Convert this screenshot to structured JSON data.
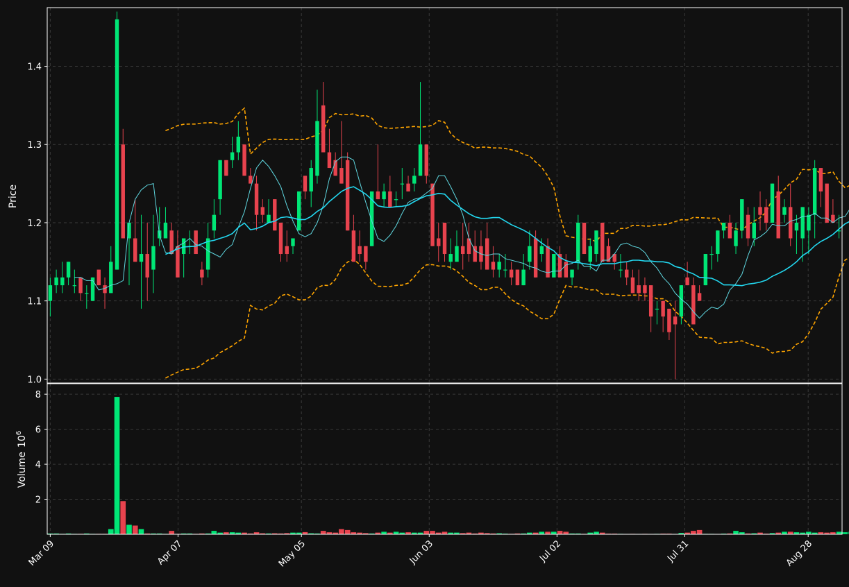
{
  "colors": {
    "background": "#111111",
    "axes_frame": "#ffffff",
    "grid": "#3a3a3a",
    "text": "#ffffff",
    "up": "#00e676",
    "down": "#e8434e",
    "sma_fast": "#5fd7e0",
    "sma_slow": "#22d8f0",
    "bollinger": "#ffa500"
  },
  "chart_data": [
    {
      "type": "candlestick",
      "panel": "price",
      "xlabel": "",
      "ylabel": "Price",
      "ylim": [
        0.995,
        1.475
      ],
      "yticks": [
        "1.0",
        "1.1",
        "1.2",
        "1.3",
        "1.4"
      ],
      "grid": true,
      "date_range": [
        "2015-03-09",
        "2015-09-04"
      ],
      "x_ticks": [
        {
          "date": "2015-03-09",
          "label": "Mar 09"
        },
        {
          "date": "2015-04-07",
          "label": "Apr 07"
        },
        {
          "date": "2015-05-05",
          "label": "May 05"
        },
        {
          "date": "2015-06-03",
          "label": "Jun 03"
        },
        {
          "date": "2015-07-02",
          "label": "Jul 02"
        },
        {
          "date": "2015-07-31",
          "label": "Jul 31"
        },
        {
          "date": "2015-08-28",
          "label": "Aug 28"
        }
      ],
      "close": [
        1.12,
        1.13,
        1.13,
        1.15,
        1.12,
        1.12,
        1.11,
        1.13,
        1.09,
        1.13,
        1.14,
        1.12,
        1.15,
        1.46,
        1.28,
        1.2,
        1.15,
        1.16,
        1.13,
        1.17,
        1.19,
        1.2,
        1.18,
        1.16,
        1.13,
        1.18,
        1.17,
        1.16,
        1.14,
        1.18,
        1.21,
        1.28,
        1.26,
        1.29,
        1.31,
        1.26,
        1.24,
        1.2,
        1.22,
        1.19,
        1.16,
        1.16,
        1.18,
        1.24,
        1.26,
        1.27,
        1.33,
        1.29,
        1.27,
        1.26,
        1.25,
        1.19,
        1.16,
        1.15,
        1.15,
        1.23,
        1.23,
        1.22,
        1.23,
        1.22,
        1.25,
        1.24,
        1.25,
        1.26,
        1.3,
        1.25,
        1.17,
        1.17,
        1.16,
        1.15,
        1.17,
        1.15,
        1.16,
        1.17,
        1.15,
        1.14,
        1.14,
        1.15,
        1.16,
        1.13,
        1.13,
        1.12,
        1.14,
        1.17,
        1.13,
        1.17,
        1.13,
        1.16,
        1.13,
        1.13,
        1.14,
        1.2,
        1.16,
        1.17,
        1.19,
        1.15,
        1.18,
        1.15,
        1.14,
        1.13,
        1.11,
        1.12,
        1.11,
        1.08,
        1.09,
        1.08,
        1.07,
        1.07,
        1.12,
        1.12,
        1.07,
        1.1,
        1.16,
        1.16,
        1.18,
        1.19,
        1.2,
        1.18,
        1.19,
        1.23,
        1.18,
        1.2,
        1.21,
        1.2,
        1.25,
        1.18,
        1.22,
        1.18,
        1.2,
        1.22,
        1.21,
        1.23,
        1.24,
        1.25,
        1.2,
        1.2,
        1.19
      ],
      "candles": [
        {
          "o": 1.1,
          "h": 1.13,
          "l": 1.08,
          "c": 1.12
        },
        {
          "o": 1.12,
          "h": 1.14,
          "l": 1.11,
          "c": 1.13
        },
        {
          "o": 1.12,
          "h": 1.15,
          "l": 1.11,
          "c": 1.13
        },
        {
          "o": 1.13,
          "h": 1.15,
          "l": 1.12,
          "c": 1.15
        },
        {
          "o": 1.12,
          "h": 1.14,
          "l": 1.11,
          "c": 1.12
        },
        {
          "o": 1.13,
          "h": 1.13,
          "l": 1.1,
          "c": 1.11
        },
        {
          "o": 1.11,
          "h": 1.12,
          "l": 1.09,
          "c": 1.11
        },
        {
          "o": 1.1,
          "h": 1.13,
          "l": 1.1,
          "c": 1.13
        },
        {
          "o": 1.14,
          "h": 1.14,
          "l": 1.12,
          "c": 1.12
        },
        {
          "o": 1.12,
          "h": 1.13,
          "l": 1.09,
          "c": 1.11
        },
        {
          "o": 1.11,
          "h": 1.17,
          "l": 1.11,
          "c": 1.15
        },
        {
          "o": 1.14,
          "h": 1.47,
          "l": 1.14,
          "c": 1.46
        },
        {
          "o": 1.3,
          "h": 1.32,
          "l": 1.18,
          "c": 1.18
        },
        {
          "o": 1.18,
          "h": 1.2,
          "l": 1.12,
          "c": 1.2
        },
        {
          "o": 1.18,
          "h": 1.23,
          "l": 1.15,
          "c": 1.15
        },
        {
          "o": 1.15,
          "h": 1.21,
          "l": 1.09,
          "c": 1.16
        },
        {
          "o": 1.16,
          "h": 1.2,
          "l": 1.1,
          "c": 1.13
        },
        {
          "o": 1.14,
          "h": 1.21,
          "l": 1.11,
          "c": 1.17
        },
        {
          "o": 1.18,
          "h": 1.22,
          "l": 1.17,
          "c": 1.19
        },
        {
          "o": 1.18,
          "h": 1.22,
          "l": 1.18,
          "c": 1.2
        },
        {
          "o": 1.19,
          "h": 1.2,
          "l": 1.16,
          "c": 1.16
        },
        {
          "o": 1.17,
          "h": 1.19,
          "l": 1.13,
          "c": 1.13
        },
        {
          "o": 1.16,
          "h": 1.18,
          "l": 1.13,
          "c": 1.18
        },
        {
          "o": 1.17,
          "h": 1.19,
          "l": 1.16,
          "c": 1.17
        },
        {
          "o": 1.19,
          "h": 1.19,
          "l": 1.16,
          "c": 1.16
        },
        {
          "o": 1.14,
          "h": 1.15,
          "l": 1.12,
          "c": 1.13
        },
        {
          "o": 1.14,
          "h": 1.2,
          "l": 1.13,
          "c": 1.18
        },
        {
          "o": 1.19,
          "h": 1.23,
          "l": 1.18,
          "c": 1.21
        },
        {
          "o": 1.23,
          "h": 1.28,
          "l": 1.21,
          "c": 1.28
        },
        {
          "o": 1.28,
          "h": 1.28,
          "l": 1.26,
          "c": 1.26
        },
        {
          "o": 1.28,
          "h": 1.31,
          "l": 1.27,
          "c": 1.29
        },
        {
          "o": 1.29,
          "h": 1.33,
          "l": 1.28,
          "c": 1.31
        },
        {
          "o": 1.3,
          "h": 1.3,
          "l": 1.26,
          "c": 1.26
        },
        {
          "o": 1.26,
          "h": 1.27,
          "l": 1.25,
          "c": 1.25
        },
        {
          "o": 1.25,
          "h": 1.26,
          "l": 1.19,
          "c": 1.21
        },
        {
          "o": 1.22,
          "h": 1.23,
          "l": 1.2,
          "c": 1.21
        },
        {
          "o": 1.2,
          "h": 1.23,
          "l": 1.2,
          "c": 1.21
        },
        {
          "o": 1.23,
          "h": 1.23,
          "l": 1.19,
          "c": 1.19
        },
        {
          "o": 1.2,
          "h": 1.2,
          "l": 1.15,
          "c": 1.16
        },
        {
          "o": 1.17,
          "h": 1.19,
          "l": 1.15,
          "c": 1.16
        },
        {
          "o": 1.17,
          "h": 1.18,
          "l": 1.16,
          "c": 1.18
        },
        {
          "o": 1.19,
          "h": 1.24,
          "l": 1.19,
          "c": 1.24
        },
        {
          "o": 1.26,
          "h": 1.26,
          "l": 1.23,
          "c": 1.24
        },
        {
          "o": 1.24,
          "h": 1.28,
          "l": 1.22,
          "c": 1.27
        },
        {
          "o": 1.26,
          "h": 1.37,
          "l": 1.25,
          "c": 1.33
        },
        {
          "o": 1.35,
          "h": 1.38,
          "l": 1.29,
          "c": 1.29
        },
        {
          "o": 1.29,
          "h": 1.32,
          "l": 1.27,
          "c": 1.27
        },
        {
          "o": 1.28,
          "h": 1.29,
          "l": 1.26,
          "c": 1.26
        },
        {
          "o": 1.27,
          "h": 1.33,
          "l": 1.25,
          "c": 1.25
        },
        {
          "o": 1.28,
          "h": 1.29,
          "l": 1.19,
          "c": 1.19
        },
        {
          "o": 1.19,
          "h": 1.21,
          "l": 1.15,
          "c": 1.15
        },
        {
          "o": 1.17,
          "h": 1.19,
          "l": 1.15,
          "c": 1.16
        },
        {
          "o": 1.17,
          "h": 1.17,
          "l": 1.14,
          "c": 1.15
        },
        {
          "o": 1.17,
          "h": 1.24,
          "l": 1.17,
          "c": 1.24
        },
        {
          "o": 1.24,
          "h": 1.3,
          "l": 1.23,
          "c": 1.23
        },
        {
          "o": 1.23,
          "h": 1.25,
          "l": 1.22,
          "c": 1.24
        },
        {
          "o": 1.24,
          "h": 1.26,
          "l": 1.22,
          "c": 1.22
        },
        {
          "o": 1.23,
          "h": 1.24,
          "l": 1.22,
          "c": 1.23
        },
        {
          "o": 1.25,
          "h": 1.27,
          "l": 1.23,
          "c": 1.25
        },
        {
          "o": 1.25,
          "h": 1.26,
          "l": 1.24,
          "c": 1.24
        },
        {
          "o": 1.25,
          "h": 1.27,
          "l": 1.24,
          "c": 1.26
        },
        {
          "o": 1.26,
          "h": 1.38,
          "l": 1.26,
          "c": 1.3
        },
        {
          "o": 1.3,
          "h": 1.3,
          "l": 1.25,
          "c": 1.26
        },
        {
          "o": 1.25,
          "h": 1.25,
          "l": 1.17,
          "c": 1.17
        },
        {
          "o": 1.18,
          "h": 1.2,
          "l": 1.15,
          "c": 1.17
        },
        {
          "o": 1.2,
          "h": 1.2,
          "l": 1.15,
          "c": 1.16
        },
        {
          "o": 1.15,
          "h": 1.18,
          "l": 1.14,
          "c": 1.16
        },
        {
          "o": 1.15,
          "h": 1.19,
          "l": 1.15,
          "c": 1.17
        },
        {
          "o": 1.17,
          "h": 1.2,
          "l": 1.14,
          "c": 1.16
        },
        {
          "o": 1.18,
          "h": 1.2,
          "l": 1.15,
          "c": 1.16
        },
        {
          "o": 1.17,
          "h": 1.19,
          "l": 1.16,
          "c": 1.15
        },
        {
          "o": 1.17,
          "h": 1.19,
          "l": 1.14,
          "c": 1.15
        },
        {
          "o": 1.18,
          "h": 1.2,
          "l": 1.14,
          "c": 1.14
        },
        {
          "o": 1.15,
          "h": 1.17,
          "l": 1.13,
          "c": 1.14
        },
        {
          "o": 1.14,
          "h": 1.16,
          "l": 1.13,
          "c": 1.15
        },
        {
          "o": 1.14,
          "h": 1.16,
          "l": 1.13,
          "c": 1.14
        },
        {
          "o": 1.14,
          "h": 1.15,
          "l": 1.12,
          "c": 1.13
        },
        {
          "o": 1.14,
          "h": 1.14,
          "l": 1.12,
          "c": 1.12
        },
        {
          "o": 1.12,
          "h": 1.16,
          "l": 1.12,
          "c": 1.14
        },
        {
          "o": 1.15,
          "h": 1.19,
          "l": 1.14,
          "c": 1.17
        },
        {
          "o": 1.18,
          "h": 1.19,
          "l": 1.13,
          "c": 1.13
        },
        {
          "o": 1.16,
          "h": 1.18,
          "l": 1.15,
          "c": 1.17
        },
        {
          "o": 1.17,
          "h": 1.18,
          "l": 1.13,
          "c": 1.13
        },
        {
          "o": 1.13,
          "h": 1.16,
          "l": 1.13,
          "c": 1.16
        },
        {
          "o": 1.16,
          "h": 1.17,
          "l": 1.13,
          "c": 1.13
        },
        {
          "o": 1.15,
          "h": 1.16,
          "l": 1.13,
          "c": 1.13
        },
        {
          "o": 1.13,
          "h": 1.14,
          "l": 1.12,
          "c": 1.14
        },
        {
          "o": 1.15,
          "h": 1.21,
          "l": 1.14,
          "c": 1.2
        },
        {
          "o": 1.2,
          "h": 1.2,
          "l": 1.16,
          "c": 1.16
        },
        {
          "o": 1.15,
          "h": 1.18,
          "l": 1.14,
          "c": 1.17
        },
        {
          "o": 1.16,
          "h": 1.19,
          "l": 1.15,
          "c": 1.19
        },
        {
          "o": 1.2,
          "h": 1.2,
          "l": 1.15,
          "c": 1.15
        },
        {
          "o": 1.17,
          "h": 1.18,
          "l": 1.15,
          "c": 1.15
        },
        {
          "o": 1.16,
          "h": 1.16,
          "l": 1.14,
          "c": 1.15
        },
        {
          "o": 1.14,
          "h": 1.16,
          "l": 1.13,
          "c": 1.14
        },
        {
          "o": 1.14,
          "h": 1.15,
          "l": 1.12,
          "c": 1.13
        },
        {
          "o": 1.13,
          "h": 1.14,
          "l": 1.11,
          "c": 1.11
        },
        {
          "o": 1.12,
          "h": 1.14,
          "l": 1.1,
          "c": 1.11
        },
        {
          "o": 1.12,
          "h": 1.13,
          "l": 1.1,
          "c": 1.11
        },
        {
          "o": 1.12,
          "h": 1.12,
          "l": 1.06,
          "c": 1.08
        },
        {
          "o": 1.09,
          "h": 1.1,
          "l": 1.07,
          "c": 1.09
        },
        {
          "o": 1.1,
          "h": 1.1,
          "l": 1.06,
          "c": 1.08
        },
        {
          "o": 1.09,
          "h": 1.09,
          "l": 1.05,
          "c": 1.06
        },
        {
          "o": 1.08,
          "h": 1.1,
          "l": 1,
          "c": 1.07
        },
        {
          "o": 1.08,
          "h": 1.12,
          "l": 1.07,
          "c": 1.12
        },
        {
          "o": 1.13,
          "h": 1.15,
          "l": 1.12,
          "c": 1.12
        },
        {
          "o": 1.12,
          "h": 1.13,
          "l": 1.07,
          "c": 1.07
        },
        {
          "o": 1.11,
          "h": 1.12,
          "l": 1.1,
          "c": 1.1
        },
        {
          "o": 1.12,
          "h": 1.16,
          "l": 1.12,
          "c": 1.16
        },
        {
          "o": 1.16,
          "h": 1.17,
          "l": 1.14,
          "c": 1.16
        },
        {
          "o": 1.16,
          "h": 1.19,
          "l": 1.15,
          "c": 1.19
        },
        {
          "o": 1.19,
          "h": 1.2,
          "l": 1.18,
          "c": 1.2
        },
        {
          "o": 1.2,
          "h": 1.21,
          "l": 1.18,
          "c": 1.18
        },
        {
          "o": 1.17,
          "h": 1.2,
          "l": 1.16,
          "c": 1.19
        },
        {
          "o": 1.19,
          "h": 1.23,
          "l": 1.18,
          "c": 1.23
        },
        {
          "o": 1.21,
          "h": 1.22,
          "l": 1.17,
          "c": 1.18
        },
        {
          "o": 1.18,
          "h": 1.22,
          "l": 1.17,
          "c": 1.2
        },
        {
          "o": 1.22,
          "h": 1.24,
          "l": 1.19,
          "c": 1.21
        },
        {
          "o": 1.22,
          "h": 1.23,
          "l": 1.19,
          "c": 1.2
        },
        {
          "o": 1.2,
          "h": 1.25,
          "l": 1.2,
          "c": 1.25
        },
        {
          "o": 1.24,
          "h": 1.26,
          "l": 1.2,
          "c": 1.18
        },
        {
          "o": 1.21,
          "h": 1.23,
          "l": 1.2,
          "c": 1.22
        },
        {
          "o": 1.22,
          "h": 1.25,
          "l": 1.17,
          "c": 1.18
        },
        {
          "o": 1.19,
          "h": 1.21,
          "l": 1.16,
          "c": 1.2
        },
        {
          "o": 1.18,
          "h": 1.22,
          "l": 1.15,
          "c": 1.22
        },
        {
          "o": 1.19,
          "h": 1.22,
          "l": 1.16,
          "c": 1.21
        },
        {
          "o": 1.21,
          "h": 1.28,
          "l": 1.18,
          "c": 1.27
        },
        {
          "o": 1.27,
          "h": 1.27,
          "l": 1.22,
          "c": 1.24
        },
        {
          "o": 1.25,
          "h": 1.25,
          "l": 1.2,
          "c": 1.2
        },
        {
          "o": 1.21,
          "h": 1.23,
          "l": 1.2,
          "c": 1.2
        },
        {
          "o": 1.19,
          "h": 1.21,
          "l": 1.18,
          "c": 1.19
        }
      ],
      "moving_averages": [
        {
          "period": 5,
          "color": "#5fd7e0"
        },
        {
          "period": 20,
          "color": "#22d8f0"
        }
      ],
      "bollinger": {
        "period": 20,
        "std_mult": 2,
        "color": "#ffa500",
        "style": "dashed"
      }
    },
    {
      "type": "bar",
      "panel": "volume",
      "ylabel": "Volume",
      "ylabel_exponent": "10",
      "ylabel_exponent_power": "6",
      "ylim": [
        0,
        8.6
      ],
      "yticks": [
        "2",
        "4",
        "6",
        "8"
      ],
      "grid": true,
      "values": [
        0.05,
        0.05,
        0.03,
        0.05,
        0.03,
        0.03,
        0.05,
        0.03,
        0.03,
        0.03,
        0.3,
        7.85,
        1.9,
        0.55,
        0.5,
        0.3,
        0.05,
        0.05,
        0.05,
        0.03,
        0.2,
        0.03,
        0.05,
        0.05,
        0.03,
        0.05,
        0.05,
        0.2,
        0.1,
        0.12,
        0.12,
        0.1,
        0.1,
        0.05,
        0.12,
        0.06,
        0.05,
        0.06,
        0.05,
        0.07,
        0.1,
        0.1,
        0.13,
        0.06,
        0.05,
        0.2,
        0.12,
        0.1,
        0.3,
        0.25,
        0.12,
        0.1,
        0.07,
        0.05,
        0.1,
        0.15,
        0.1,
        0.15,
        0.1,
        0.12,
        0.1,
        0.1,
        0.2,
        0.2,
        0.1,
        0.15,
        0.1,
        0.1,
        0.07,
        0.1,
        0.05,
        0.1,
        0.07,
        0.05,
        0.06,
        0.04,
        0.03,
        0.05,
        0.05,
        0.1,
        0.1,
        0.15,
        0.15,
        0.15,
        0.2,
        0.15,
        0.05,
        0.05,
        0.03,
        0.1,
        0.15,
        0.1,
        0.04,
        0.04,
        0.03,
        0.02,
        0.03,
        0.02,
        0.03,
        0.02,
        0.03,
        0.04,
        0.04,
        0.02,
        0.08,
        0.1,
        0.2,
        0.25,
        0.03,
        0.03,
        0.02,
        0.04,
        0.05,
        0.2,
        0.12,
        0.05,
        0.06,
        0.1,
        0.04,
        0.07,
        0.1,
        0.15,
        0.15,
        0.12,
        0.1,
        0.15,
        0.1,
        0.12,
        0.1,
        0.12,
        0.15,
        0.12,
        0.15,
        0.12,
        0.15,
        0.25,
        0.15,
        0.15
      ]
    }
  ]
}
